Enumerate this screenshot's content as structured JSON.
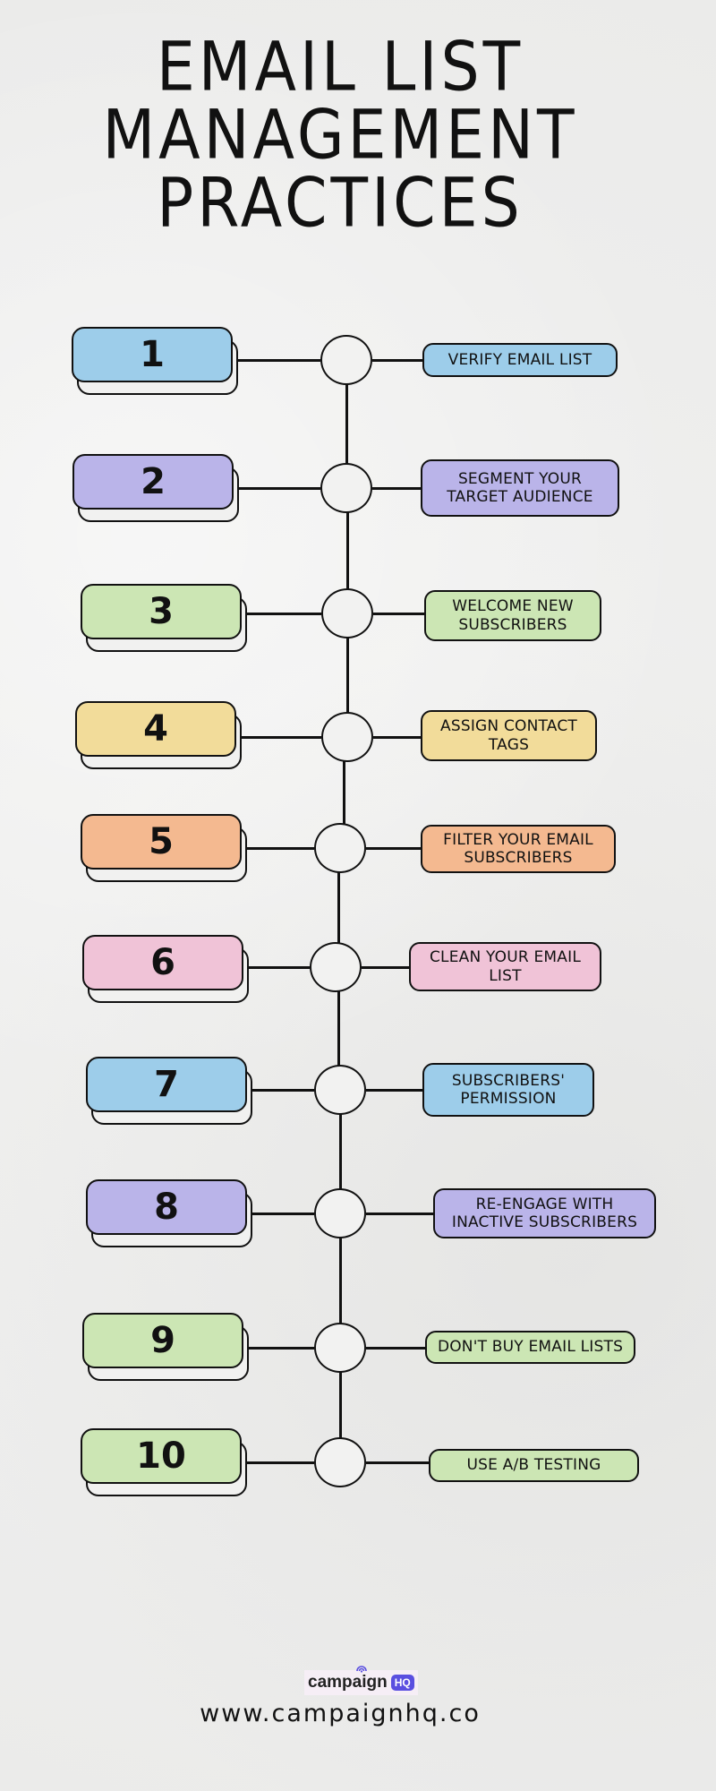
{
  "title": {
    "lines": [
      "EMAIL LIST",
      "MANAGEMENT",
      "PRACTICES"
    ]
  },
  "colors": {
    "blue": "#9dcdea",
    "purple": "#bab4e9",
    "green": "#cce6b4",
    "yellow": "#f2dc9a",
    "orange": "#f4b990",
    "pink": "#f0c3d7",
    "node_fill": "#f2f2f1",
    "outline": "#111111"
  },
  "steps": [
    {
      "number": "1",
      "label": "VERIFY EMAIL LIST",
      "color": "#9dcdea"
    },
    {
      "number": "2",
      "label": "SEGMENT YOUR TARGET AUDIENCE",
      "color": "#bab4e9"
    },
    {
      "number": "3",
      "label": "WELCOME NEW SUBSCRIBERS",
      "color": "#cce6b4"
    },
    {
      "number": "4",
      "label": "ASSIGN CONTACT TAGS",
      "color": "#f2dc9a"
    },
    {
      "number": "5",
      "label": "FILTER YOUR EMAIL SUBSCRIBERS",
      "color": "#f4b990"
    },
    {
      "number": "6",
      "label": "CLEAN YOUR EMAIL LIST",
      "color": "#f0c3d7"
    },
    {
      "number": "7",
      "label": "SUBSCRIBERS' PERMISSION",
      "color": "#9dcdea"
    },
    {
      "number": "8",
      "label": "RE-ENGAGE WITH INACTIVE SUBSCRIBERS",
      "color": "#bab4e9"
    },
    {
      "number": "9",
      "label": "DON'T BUY EMAIL LISTS",
      "color": "#cce6b4"
    },
    {
      "number": "10",
      "label": "USE A/B TESTING",
      "color": "#cce6b4"
    }
  ],
  "footer": {
    "logo_word": "campaign",
    "logo_badge": "HQ",
    "logo_icon": "broadcast-signal-icon",
    "badge_color": "#5a4fe0",
    "url": "www.campaignhq.co"
  }
}
